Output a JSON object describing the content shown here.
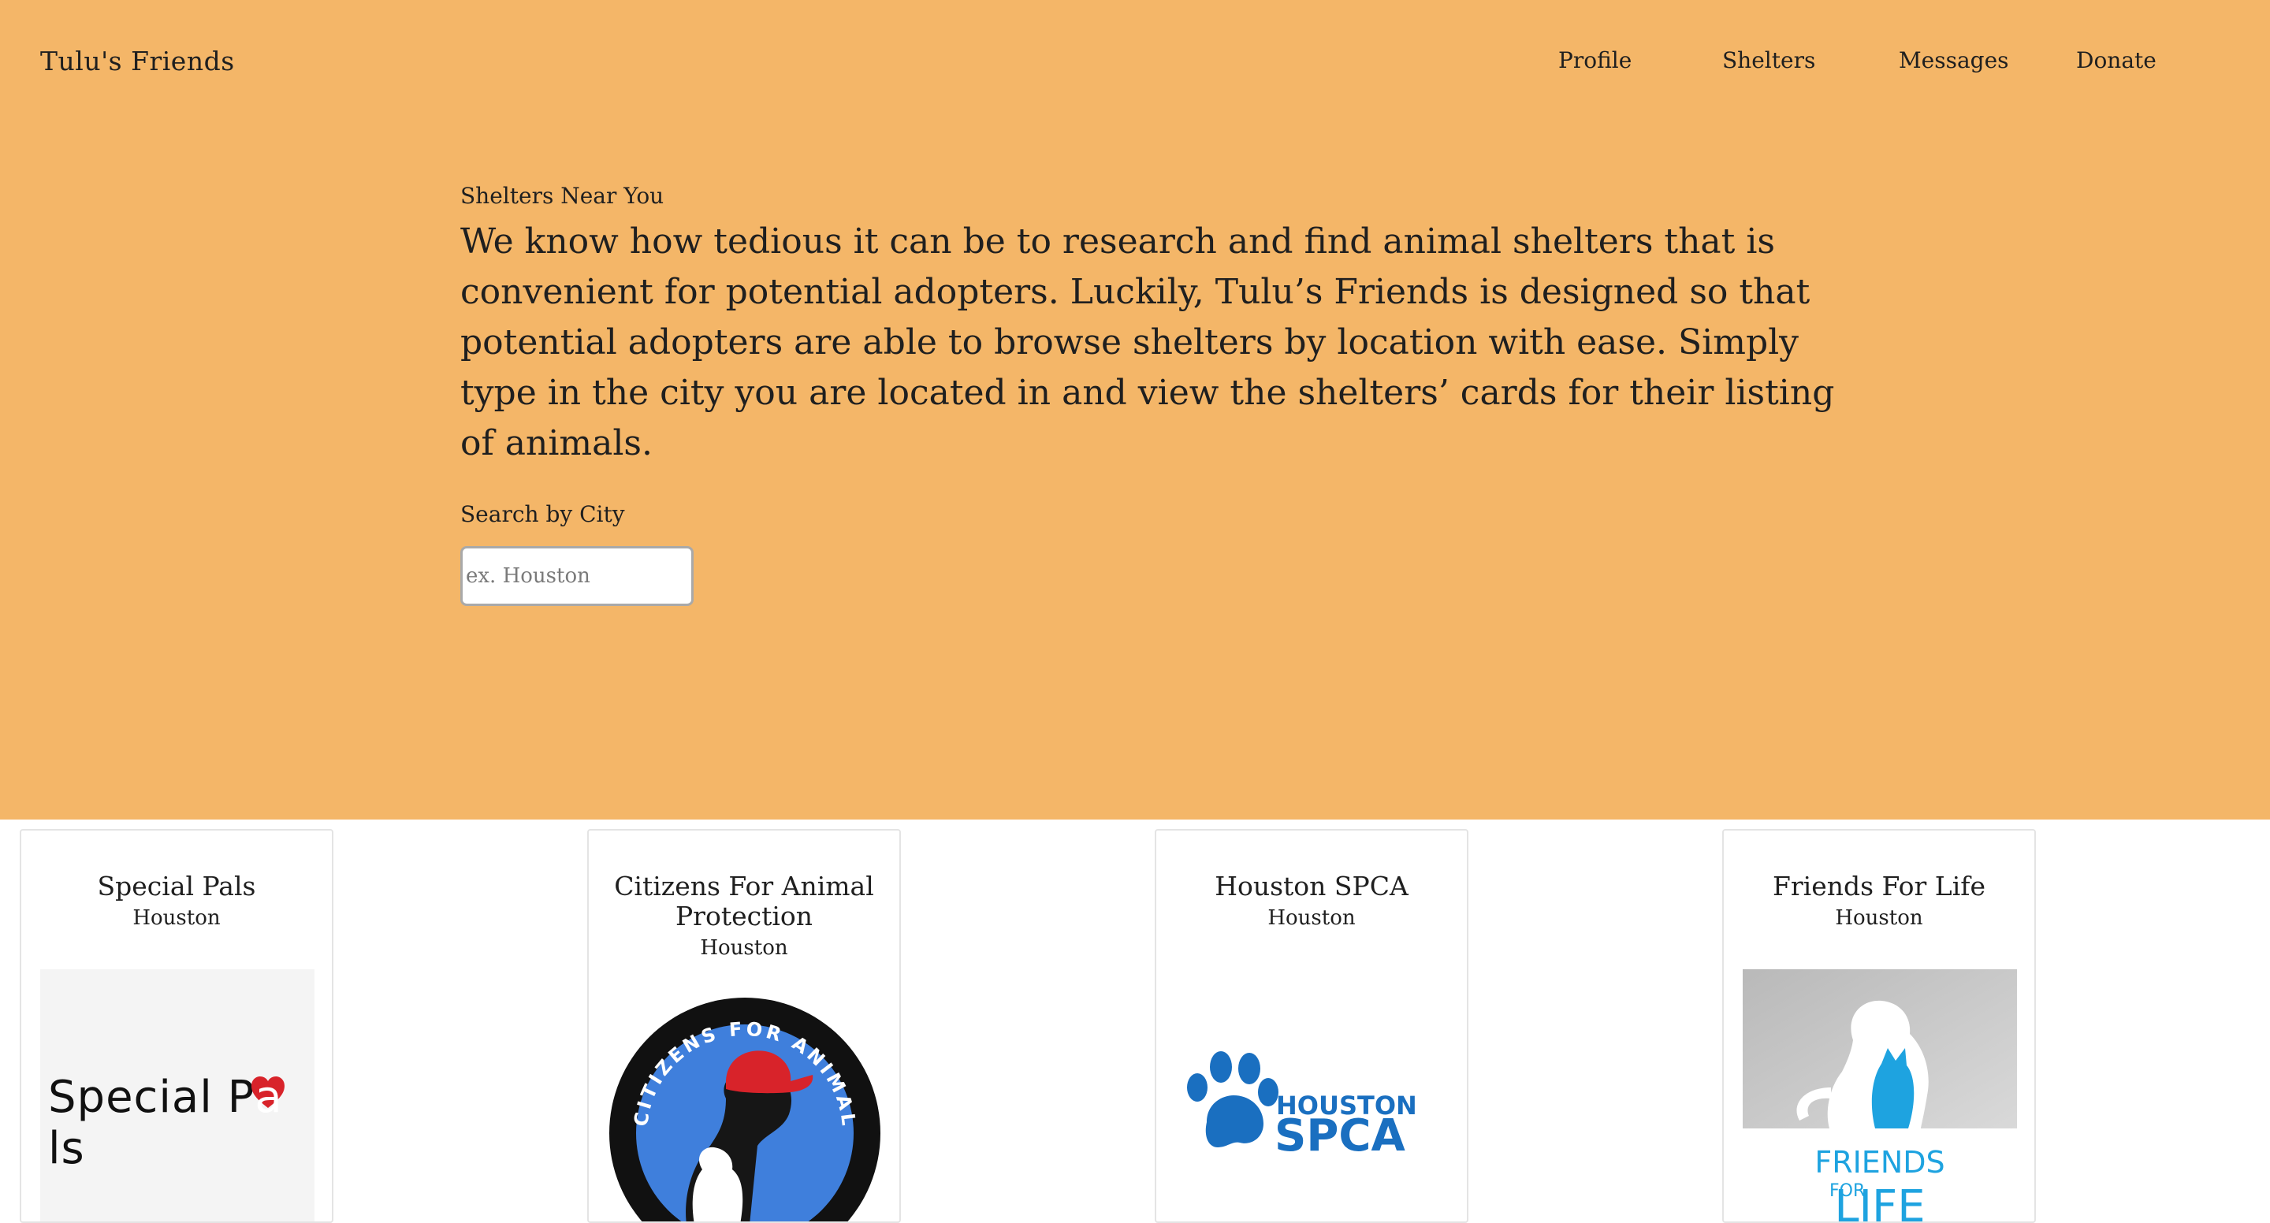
{
  "header": {
    "brand": "Tulu's Friends",
    "nav": {
      "profile": "Profile",
      "shelters": "Shelters",
      "messages": "Messages",
      "donate": "Donate"
    }
  },
  "intro": {
    "label": "Shelters Near You",
    "text": "We know how tedious it can be to research and find animal shelters that is convenient for potential adopters. Luckily, Tulu’s Friends is designed so that potential adopters are able to browse shelters by location with ease. Simply type in the city you are located in and view the shelters’ cards for their listing of animals."
  },
  "search": {
    "label": "Search by City",
    "placeholder": "ex. Houston",
    "value": ""
  },
  "colors": {
    "hero_background": "#f4b668",
    "card_border": "#e4e4e4",
    "spca_blue": "#1a6fc0",
    "ffl_blue": "#1ea3e0",
    "cap_blue": "#3f7fdc",
    "cap_red": "#d8232a"
  },
  "shelters": [
    {
      "name": "Special Pals",
      "city": "Houston",
      "logo": {
        "icon": "special-pals-logo",
        "text_before": "Special P",
        "text_heart": "a",
        "text_after": "ls"
      }
    },
    {
      "name": "Citizens For Animal Protection",
      "city": "Houston",
      "logo": {
        "icon": "citizens-for-animal-protection-logo",
        "ring_text": "CITIZENS FOR ANIMAL PROTECTION"
      }
    },
    {
      "name": "Houston SPCA",
      "city": "Houston",
      "logo": {
        "icon": "houston-spca-logo",
        "line1": "HOUSTON",
        "line2": "SPCA"
      }
    },
    {
      "name": "Friends For Life",
      "city": "Houston",
      "logo": {
        "icon": "friends-for-life-logo",
        "line1": "FRIENDS",
        "line2": "FOR",
        "line3": "LIFE"
      }
    }
  ]
}
